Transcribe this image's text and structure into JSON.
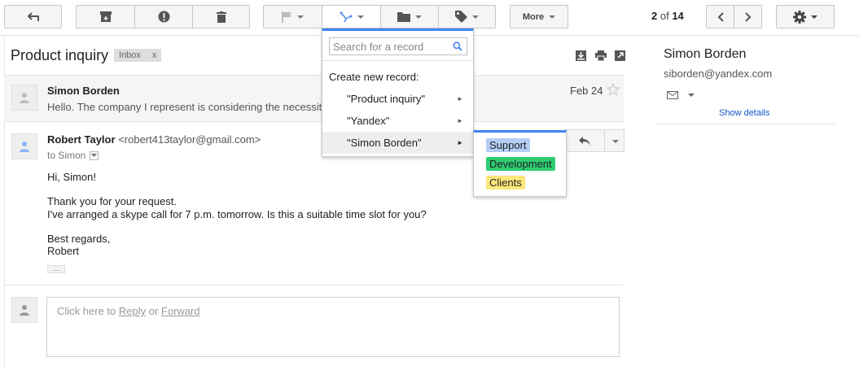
{
  "toolbar": {
    "back_icon": "back-arrow-icon",
    "archive_icon": "archive-icon",
    "spam_icon": "report-spam-icon",
    "delete_icon": "trash-icon",
    "flag_icon": "flag-icon",
    "crm_icon": "crm-record-icon",
    "move_icon": "folder-icon",
    "labels_icon": "label-tag-icon",
    "more_label": "More",
    "pager": {
      "current": "2",
      "separator": " of ",
      "total": "14"
    },
    "settings_icon": "gear-icon"
  },
  "thread": {
    "subject": "Product inquiry",
    "label": "Inbox",
    "label_remove": "x",
    "messages": [
      {
        "sender": "Simon Borden",
        "snippet": "Hello. The company I represent is considering the necessity",
        "date": "Feb 24"
      },
      {
        "sender": "Robert Taylor",
        "email": "<robert413taylor@gmail.com>",
        "to": "to Simon",
        "body": [
          "Hi, Simon!",
          "Thank you for your request.",
          "I've arranged a skype call for 7 p.m. tomorrow. Is this a suitable time slot for you?",
          "Best regards,",
          "Robert"
        ],
        "ellipsis": "..."
      }
    ],
    "reply_box": {
      "prefix": "Click here to ",
      "reply": "Reply",
      "middle": " or ",
      "forward": "Forward"
    }
  },
  "contact": {
    "name": "Simon Borden",
    "email": "siborden@yandex.com",
    "show_details": "Show details"
  },
  "dropdown": {
    "search_placeholder": "Search for a record",
    "heading": "Create new record:",
    "items": [
      {
        "label": "\"Product inquiry\"",
        "arrow": "►"
      },
      {
        "label": "\"Yandex\"",
        "arrow": "►"
      },
      {
        "label": "\"Simon Borden\"",
        "arrow": "►"
      }
    ]
  },
  "submenu": {
    "chips": [
      {
        "label": "Support",
        "color": "#b3cdf5"
      },
      {
        "label": "Development",
        "color": "#2ecc71"
      },
      {
        "label": "Clients",
        "color": "#fbe77a"
      }
    ]
  }
}
